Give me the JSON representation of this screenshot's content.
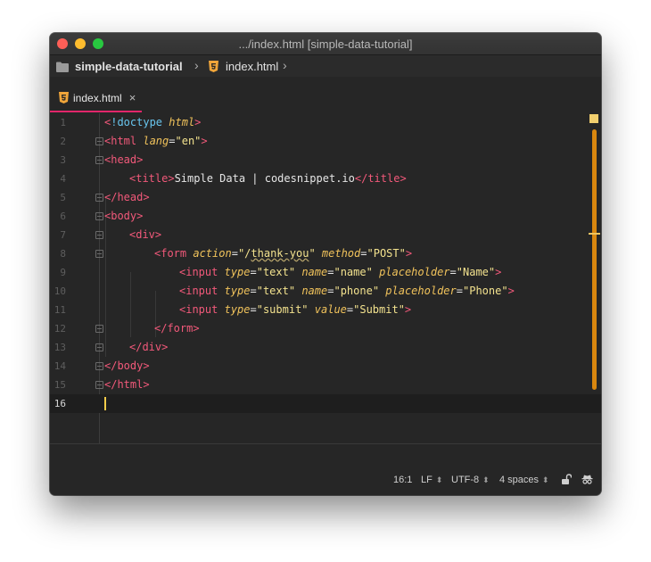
{
  "window": {
    "title": ".../index.html [simple-data-tutorial]"
  },
  "breadcrumb": {
    "folder": "simple-data-tutorial",
    "file": "index.html"
  },
  "tabs": [
    {
      "label": "index.html",
      "close": "×"
    }
  ],
  "editor": {
    "lines": [
      {
        "num": "1"
      },
      {
        "num": "2"
      },
      {
        "num": "3"
      },
      {
        "num": "4",
        "title_text": "Simple Data | codesnippet.io"
      },
      {
        "num": "5"
      },
      {
        "num": "6"
      },
      {
        "num": "7"
      },
      {
        "num": "8"
      },
      {
        "num": "9"
      },
      {
        "num": "10"
      },
      {
        "num": "11"
      },
      {
        "num": "12"
      },
      {
        "num": "13"
      },
      {
        "num": "14"
      },
      {
        "num": "15"
      },
      {
        "num": "16"
      }
    ],
    "current_line": 16
  },
  "status": {
    "position": "16:1",
    "line_ending": "LF",
    "encoding": "UTF-8",
    "indent": "4 spaces"
  },
  "colors": {
    "accent": "#e2266a",
    "tag": "#f2597a",
    "attribute": "#f0c25b",
    "string": "#f3e28e",
    "scrollbar": "#d9870f"
  }
}
